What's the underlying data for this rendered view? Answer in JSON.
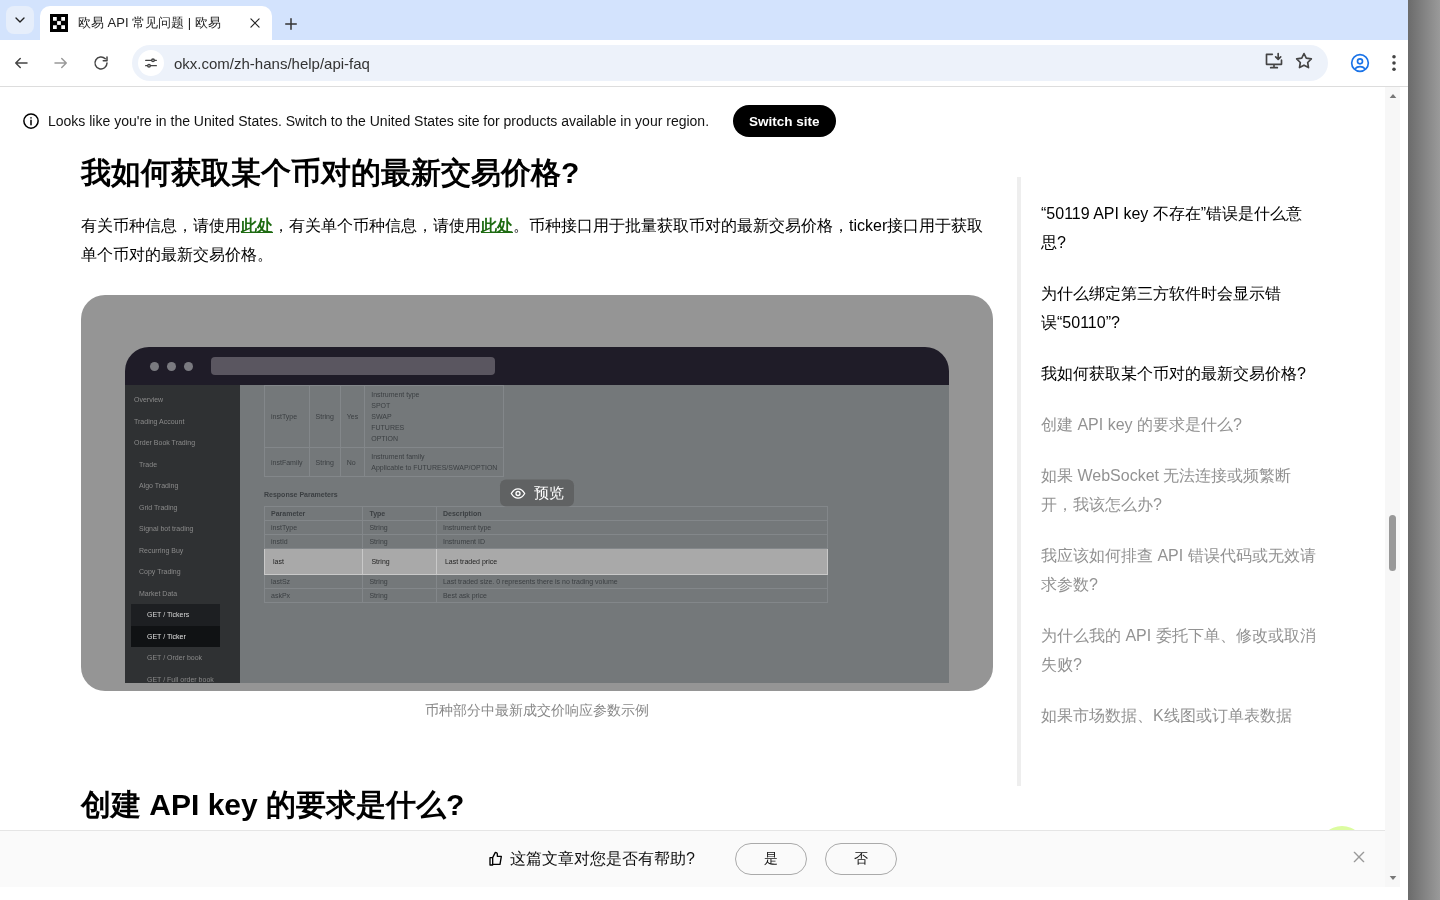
{
  "browser": {
    "tab_title": "欧易 API 常见问题 | 欧易",
    "url": "okx.com/zh-hans/help/api-faq"
  },
  "banner": {
    "message": "Looks like you're in the United States. Switch to the United States site for products available in your region.",
    "button": "Switch site"
  },
  "article": {
    "heading": "我如何获取某个币对的最新交易价格?",
    "paragraph": [
      {
        "text": "有关币种信息，请使用",
        "link": false
      },
      {
        "text": "此处",
        "link": true
      },
      {
        "text": "，有关单个币种信息，请使用",
        "link": false
      },
      {
        "text": "此处",
        "link": true
      },
      {
        "text": "。币种接口用于批量获取币对的最新交易价格，ticker接口用于获取单个币对的最新交易价格。",
        "link": false
      }
    ],
    "figure": {
      "preview_label": "预览",
      "caption": "币种部分中最新成交价响应参数示例",
      "screenshot": {
        "nav": [
          {
            "label": "Overview"
          },
          {
            "label": "Trading Account"
          },
          {
            "label": "Order Book Trading",
            "children": [
              {
                "label": "Trade"
              },
              {
                "label": "Algo Trading"
              },
              {
                "label": "Grid Trading"
              },
              {
                "label": "Signal bot trading"
              },
              {
                "label": "Recurring Buy"
              },
              {
                "label": "Copy Trading"
              },
              {
                "label": "Market Data",
                "children": [
                  {
                    "label": "GET / Tickers",
                    "callout": true,
                    "selected": false
                  },
                  {
                    "label": "GET / Ticker",
                    "callout": true,
                    "selected": true
                  },
                  {
                    "label": "GET / Order book",
                    "callout": false,
                    "selected": false
                  },
                  {
                    "label": "GET / Full order book",
                    "callout": false,
                    "selected": false
                  }
                ]
              }
            ]
          }
        ],
        "request_rows": [
          {
            "param": "instType",
            "type": "String",
            "required": "Yes",
            "description": [
              "Instrument type",
              "SPOT",
              "SWAP",
              "FUTURES",
              "OPTION"
            ]
          },
          {
            "param": "instFamily",
            "type": "String",
            "required": "No",
            "description": [
              "Instrument family",
              "Applicable to FUTURES/SWAP/OPTION"
            ]
          }
        ],
        "response_title": "Response Parameters",
        "response_columns": [
          "Parameter",
          "Type",
          "Description"
        ],
        "response_rows": [
          {
            "cells": [
              "instType",
              "String",
              "Instrument type"
            ],
            "highlighted": false
          },
          {
            "cells": [
              "instId",
              "String",
              "Instrument ID"
            ],
            "highlighted": false
          },
          {
            "cells": [
              "last",
              "String",
              "Last traded price"
            ],
            "highlighted": true
          },
          {
            "cells": [
              "lastSz",
              "String",
              "Last traded size. 0 represents there is no trading volume"
            ],
            "highlighted": false
          },
          {
            "cells": [
              "askPx",
              "String",
              "Best ask price"
            ],
            "highlighted": false
          }
        ]
      }
    },
    "next_heading": "创建 API key 的要求是什么?"
  },
  "toc": [
    {
      "label": "“50119 API key 不存在”错误是什么意思?",
      "highlighted": true
    },
    {
      "label": "为什么绑定第三方软件时会显示错误“50110”?",
      "highlighted": true
    },
    {
      "label": "我如何获取某个币对的最新交易价格?",
      "highlighted": true
    },
    {
      "label": "创建 API key 的要求是什么?",
      "highlighted": false
    },
    {
      "label": "如果 WebSocket 无法连接或频繁断开，我该怎么办?",
      "highlighted": false
    },
    {
      "label": "我应该如何排查 API 错误代码或无效请求参数?",
      "highlighted": false
    },
    {
      "label": "为什么我的 API 委托下单、修改或取消失败?",
      "highlighted": false
    },
    {
      "label": "如果市场数据、K线图或订单表数据",
      "highlighted": false
    }
  ],
  "feedback": {
    "question": "这篇文章对您是否有帮助?",
    "buttons": [
      "是",
      "否"
    ]
  }
}
